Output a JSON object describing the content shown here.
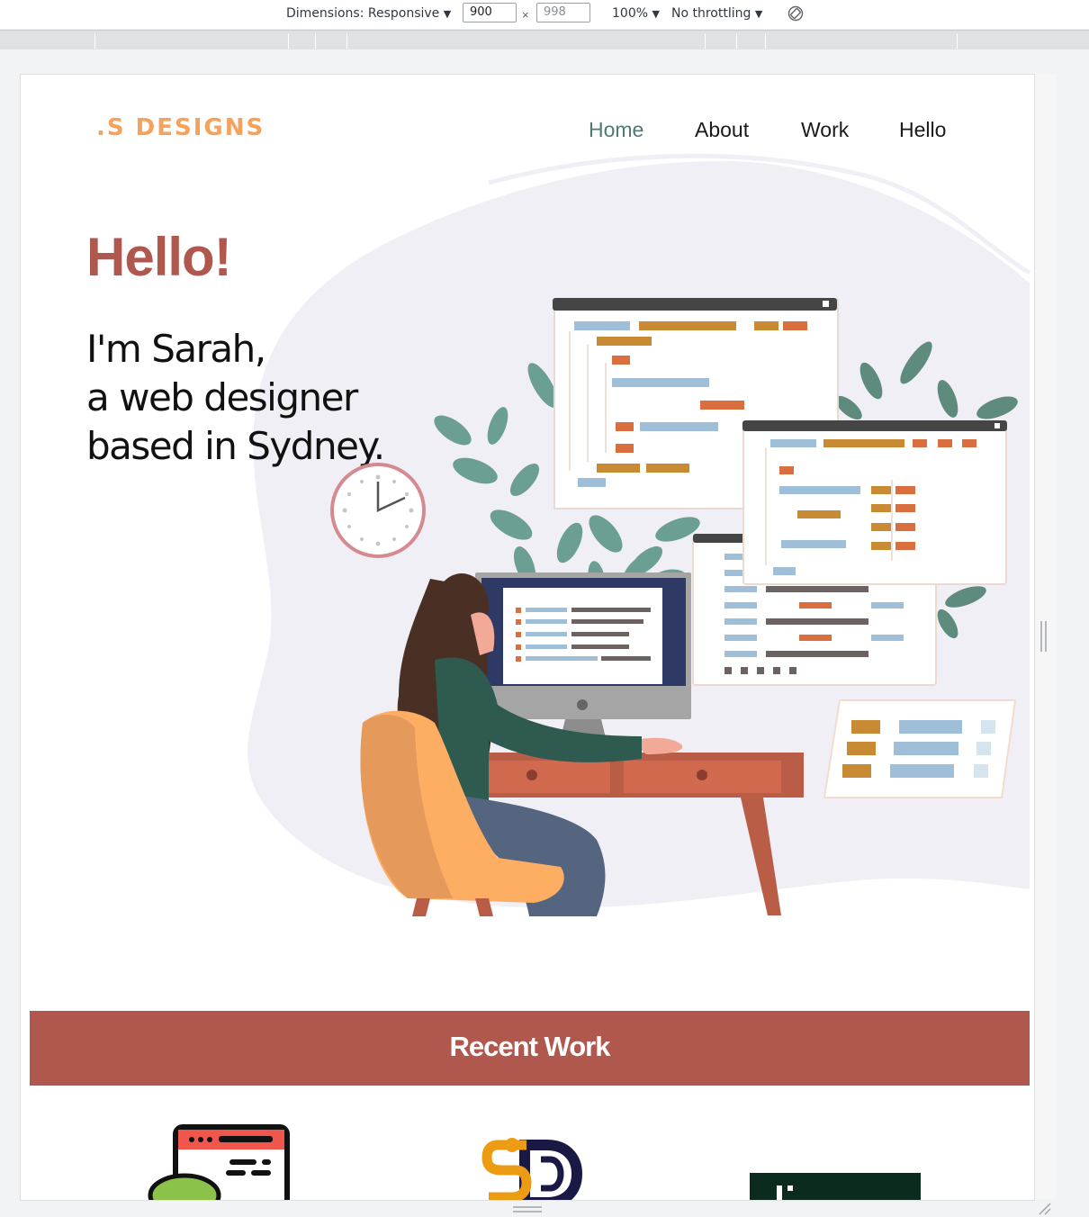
{
  "devtools": {
    "dimensions_label": "Dimensions: Responsive",
    "width_value": "900",
    "height_placeholder": "998",
    "times": "×",
    "zoom_label": "100%",
    "throttling_label": "No throttling",
    "dropdown_arrow": "▼"
  },
  "site": {
    "logo": ".S DESIGNS",
    "nav": [
      {
        "label": "Home",
        "active": true
      },
      {
        "label": "About",
        "active": false
      },
      {
        "label": "Work",
        "active": false
      },
      {
        "label": "Hello",
        "active": false
      }
    ],
    "hero": {
      "greeting": "Hello!",
      "intro_lines": [
        "I'm Sarah,",
        "a web designer",
        "based in Sydney."
      ]
    },
    "recent_work": {
      "title": "Recent Work"
    },
    "colors": {
      "accent": "#b0584d",
      "logo": "#f5a25d",
      "nav_active": "#4e7a78",
      "blob": "#f0eff5"
    },
    "icons": [
      "rotate-icon",
      "wall-clock-icon",
      "web-code-thumbnail-icon",
      "sd-logo-thumbnail-icon",
      "dark-thumbnail-icon"
    ]
  }
}
